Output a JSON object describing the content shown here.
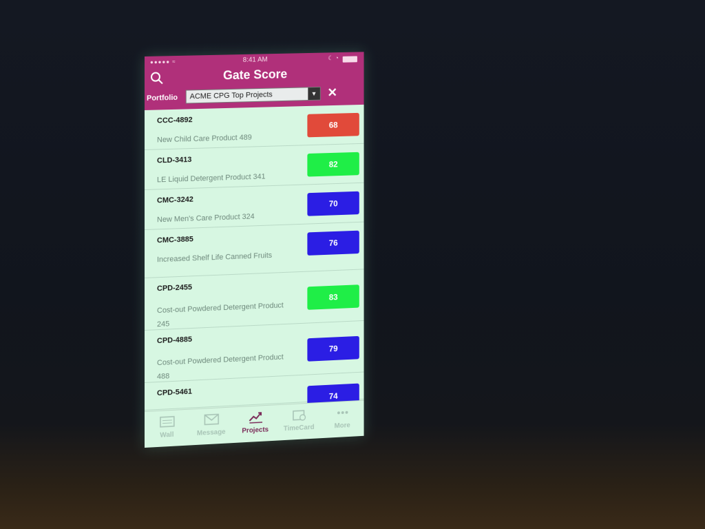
{
  "status_bar": {
    "signal": "●●●●● ≈",
    "time": "8:41 AM",
    "moon": "☾ ◔"
  },
  "header": {
    "title": "Gate Score",
    "portfolio_label": "Portfolio",
    "portfolio_selected": "ACME CPG Top Projects"
  },
  "colors": {
    "header": "#b0307a",
    "background": "#d7f7e2",
    "score_red": "#e14a3a",
    "score_green": "#1fee47",
    "score_blue": "#2b1ee4"
  },
  "projects": [
    {
      "code": "CCC-4892",
      "name": "New Child Care Product 489",
      "score": "68",
      "status": "red"
    },
    {
      "code": "CLD-3413",
      "name": "LE Liquid Detergent Product 341",
      "score": "82",
      "status": "green"
    },
    {
      "code": "CMC-3242",
      "name": "New Men's Care Product 324",
      "score": "70",
      "status": "blue"
    },
    {
      "code": "CMC-3885",
      "name": "Increased Shelf Life Canned Fruits",
      "score": "76",
      "status": "blue"
    },
    {
      "code": "CPD-2455",
      "name": "Cost-out Powdered Detergent Product 245",
      "score": "83",
      "status": "green"
    },
    {
      "code": "CPD-4885",
      "name": "Cost-out Powdered Detergent Product 488",
      "score": "79",
      "status": "blue"
    },
    {
      "code": "CPD-5461",
      "name": "",
      "score": "74",
      "status": "blue"
    }
  ],
  "tabs": [
    {
      "label": "Wall",
      "icon": "wall-icon",
      "active": false
    },
    {
      "label": "Message",
      "icon": "message-icon",
      "active": false
    },
    {
      "label": "Projects",
      "icon": "chart-icon",
      "active": true
    },
    {
      "label": "TimeCard",
      "icon": "timecard-icon",
      "active": false
    },
    {
      "label": "More",
      "icon": "more-icon",
      "active": false
    }
  ]
}
